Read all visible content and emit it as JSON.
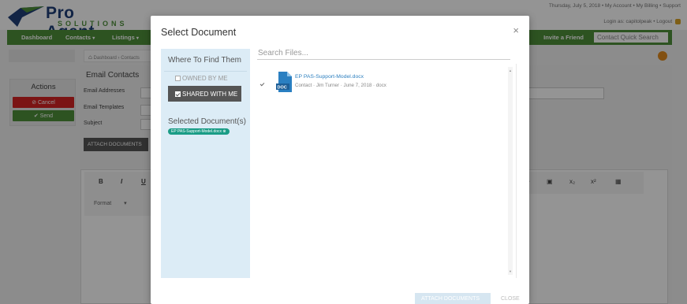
{
  "app": {
    "logo_name": "Pro Agent",
    "logo_sub": "SOLUTIONS",
    "top_links": "Thursday, July 5, 2018 • My Account • My Billing • Support",
    "login_line": "Login as: capitolpeak • Logout",
    "nav": [
      "Dashboard",
      "Contacts",
      "Listings"
    ],
    "invite": "Invite a Friend",
    "quick_search": "Contact Quick Search",
    "breadcrumb": [
      "Dashboard",
      "Contacts"
    ],
    "actions_title": "Actions",
    "cancel_label": "Cancel",
    "send_label": "Send",
    "email_title": "Email Contacts",
    "field_labels": [
      "Email Addresses",
      "Email Templates",
      "Subject"
    ],
    "attach_button": "ATTACH DOCUMENTS",
    "editor": {
      "bold": "B",
      "italic": "I",
      "underline": "U",
      "format": "Format",
      "right_tools": [
        "⚭",
        "▣",
        "x₂",
        "x²",
        "▦"
      ]
    }
  },
  "modal": {
    "title": "Select Document",
    "close": "×",
    "where_title": "Where To Find Them",
    "owned_by_me": "OWNED BY ME",
    "shared_with_me": "SHARED WITH ME",
    "selected_title": "Selected Document(s)",
    "selected_chip": "EP PAS-Support-Model.docx ⊗",
    "search_placeholder": "Search Files...",
    "files": [
      {
        "name": "EP PAS-Support-Model.docx",
        "meta": "Contact · Jim Turner · June 7, 2018 · docx",
        "icon": "doc",
        "checked": true
      }
    ],
    "attach_footer": "ATTACH DOCUMENTS",
    "close_footer": "CLOSE"
  },
  "colors": {
    "brand_blue": "#1f3f78",
    "brand_green": "#4e8f3a",
    "danger": "#d42424",
    "chip_teal": "#1a9c86",
    "panel_blue": "#dcecf6"
  }
}
